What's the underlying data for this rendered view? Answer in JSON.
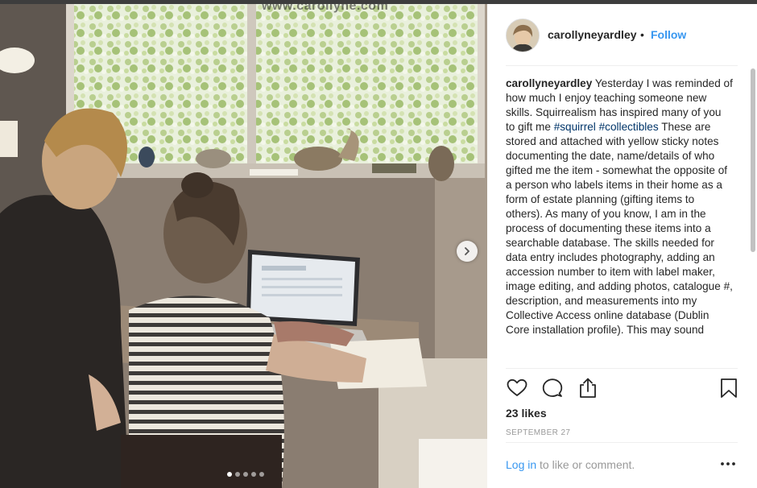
{
  "photo": {
    "watermark": "www.carollyne.com",
    "carousel_total": 5,
    "carousel_active": 1
  },
  "post": {
    "username": "carollyneyardley",
    "separator": "•",
    "follow": "Follow",
    "caption_user": "carollyneyardley",
    "caption_part1": " Yesterday I was reminded of how much I enjoy teaching someone new skills. Squirrealism has inspired many of you to gift me ",
    "tag1": "#squirrel",
    "caption_part2": " ",
    "tag2": "#collectibles",
    "caption_part3": " These are stored and attached with yellow sticky notes documenting the date, name/details of who gifted me the item - somewhat the opposite of a person who labels items in their home as a form of estate planning (gifting items to others). As many of you know, I am in the process of documenting these items into a searchable database. The skills needed for data entry includes photography, adding an accession number to item with label maker, image editing, and adding photos, catalogue #, description, and measurements into my Collective Access online database (Dublin Core installation profile). This may sound",
    "likes": "23 likes",
    "date": "SEPTEMBER 27",
    "login_link": "Log in",
    "login_rest": " to like or comment."
  },
  "icons": {
    "like": "heart-icon",
    "comment": "comment-icon",
    "share": "share-icon",
    "save": "bookmark-icon",
    "more": "more-options-icon",
    "next": "chevron-right-icon"
  },
  "colors": {
    "link": "#3897f0",
    "hashtag": "#003569",
    "muted": "#999999",
    "text": "#262626"
  }
}
